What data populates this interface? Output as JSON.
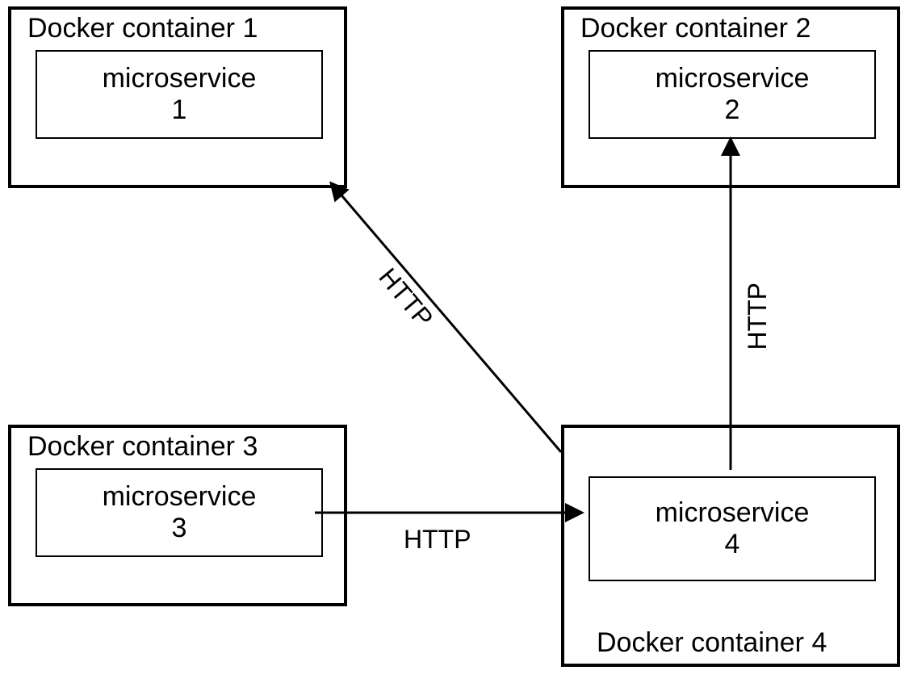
{
  "containers": {
    "c1": {
      "title": "Docker container 1",
      "service_name": "microservice",
      "service_num": "1"
    },
    "c2": {
      "title": "Docker container 2",
      "service_name": "microservice",
      "service_num": "2"
    },
    "c3": {
      "title": "Docker container 3",
      "service_name": "microservice",
      "service_num": "3"
    },
    "c4": {
      "title": "Docker container 4",
      "service_name": "microservice",
      "service_num": "4"
    }
  },
  "edges": {
    "e34": "HTTP",
    "e42": "HTTP",
    "e41": "HTTP"
  }
}
